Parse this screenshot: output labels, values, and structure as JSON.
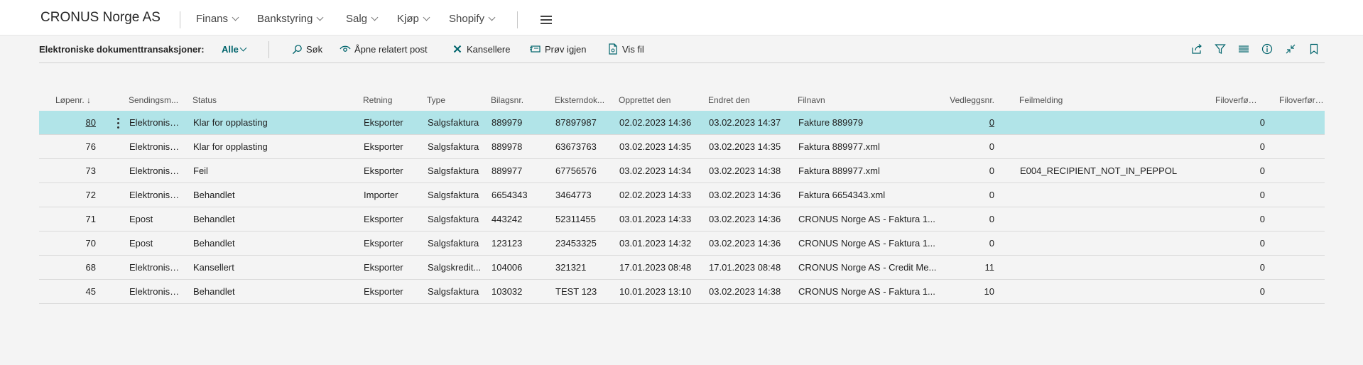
{
  "app": {
    "company": "CRONUS Norge AS",
    "menu": [
      {
        "label": "Finans"
      },
      {
        "label": "Bankstyring"
      },
      {
        "label": "Salg"
      },
      {
        "label": "Kjøp"
      },
      {
        "label": "Shopify"
      }
    ]
  },
  "actionbar": {
    "title": "Elektroniske dokumenttransaksjoner:",
    "filter": "Alle",
    "actions": {
      "search": "Søk",
      "open_related": "Åpne relatert post",
      "cancel": "Kansellere",
      "retry": "Prøv igjen",
      "view_file": "Vis fil"
    }
  },
  "table": {
    "headers": {
      "entry_no": "Løpenr. ↓",
      "sending": "Sendingsm...",
      "status": "Status",
      "direction": "Retning",
      "type": "Type",
      "doc_no": "Bilagsnr.",
      "ext_doc": "Eksterndok...",
      "created": "Opprettet den",
      "modified": "Endret den",
      "filename": "Filnavn",
      "attach": "Vedleggsnr.",
      "error": "Feilmelding",
      "file_transfer1": "Filoverføri...",
      "file_transfer2": "Filoverføring"
    },
    "rows": [
      {
        "entry_no": "80",
        "sending": "Elektronisk ...",
        "status": "Klar for opplasting",
        "direction": "Eksporter",
        "type": "Salgsfaktura",
        "doc_no": "889979",
        "ext_doc": "87897987",
        "created": "02.02.2023 14:36",
        "modified": "03.02.2023 14:37",
        "filename": "Fakture 889979",
        "attach": "0",
        "error": "",
        "file_transfer1": "0",
        "file_transfer2": ""
      },
      {
        "entry_no": "76",
        "sending": "Elektronisk ...",
        "status": "Klar for opplasting",
        "direction": "Eksporter",
        "type": "Salgsfaktura",
        "doc_no": "889978",
        "ext_doc": "63673763",
        "created": "03.02.2023 14:35",
        "modified": "03.02.2023 14:35",
        "filename": "Faktura 889977.xml",
        "attach": "0",
        "error": "",
        "file_transfer1": "0",
        "file_transfer2": ""
      },
      {
        "entry_no": "73",
        "sending": "Elektronisk ...",
        "status": "Feil",
        "direction": "Eksporter",
        "type": "Salgsfaktura",
        "doc_no": "889977",
        "ext_doc": "67756576",
        "created": "03.02.2023 14:34",
        "modified": "03.02.2023 14:38",
        "filename": "Faktura 889977.xml",
        "attach": "0",
        "error": "E004_RECIPIENT_NOT_IN_PEPPOL",
        "file_transfer1": "0",
        "file_transfer2": ""
      },
      {
        "entry_no": "72",
        "sending": "Elektronisk ...",
        "status": "Behandlet",
        "direction": "Importer",
        "type": "Salgsfaktura",
        "doc_no": "6654343",
        "ext_doc": "3464773",
        "created": "02.02.2023 14:33",
        "modified": "03.02.2023 14:36",
        "filename": "Faktura 6654343.xml",
        "attach": "0",
        "error": "",
        "file_transfer1": "0",
        "file_transfer2": ""
      },
      {
        "entry_no": "71",
        "sending": "Epost",
        "status": "Behandlet",
        "direction": "Eksporter",
        "type": "Salgsfaktura",
        "doc_no": "443242",
        "ext_doc": "52311455",
        "created": "03.01.2023 14:33",
        "modified": "03.02.2023 14:36",
        "filename": "CRONUS Norge AS - Faktura 1...",
        "attach": "0",
        "error": "",
        "file_transfer1": "0",
        "file_transfer2": ""
      },
      {
        "entry_no": "70",
        "sending": "Epost",
        "status": "Behandlet",
        "direction": "Eksporter",
        "type": "Salgsfaktura",
        "doc_no": "123123",
        "ext_doc": "23453325",
        "created": "03.01.2023 14:32",
        "modified": "03.02.2023 14:36",
        "filename": "CRONUS Norge AS - Faktura 1...",
        "attach": "0",
        "error": "",
        "file_transfer1": "0",
        "file_transfer2": ""
      },
      {
        "entry_no": "68",
        "sending": "Elektronisk ...",
        "status": "Kansellert",
        "direction": "Eksporter",
        "type": "Salgskredit...",
        "doc_no": "104006",
        "ext_doc": "321321",
        "created": "17.01.2023 08:48",
        "modified": "17.01.2023 08:48",
        "filename": "CRONUS Norge AS - Credit Me...",
        "attach": "11",
        "error": "",
        "file_transfer1": "0",
        "file_transfer2": ""
      },
      {
        "entry_no": "45",
        "sending": "Elektronisk ...",
        "status": "Behandlet",
        "direction": "Eksporter",
        "type": "Salgsfaktura",
        "doc_no": "103032",
        "ext_doc": "TEST 123",
        "created": "10.01.2023 13:10",
        "modified": "03.02.2023 14:38",
        "filename": "CRONUS Norge AS - Faktura 1...",
        "attach": "10",
        "error": "",
        "file_transfer1": "0",
        "file_transfer2": ""
      }
    ]
  },
  "colors": {
    "accent": "#00646c",
    "selected_row": "#b1e4e8",
    "background": "#f4f4f4"
  }
}
